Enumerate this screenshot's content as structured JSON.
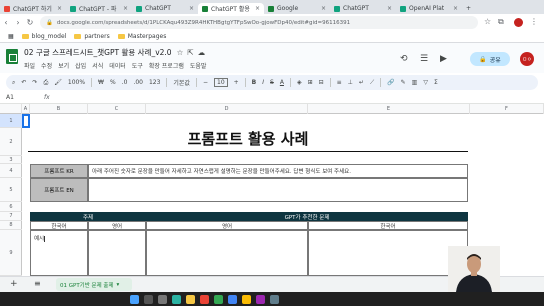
{
  "browser": {
    "tabs": [
      {
        "label": "ChatGPT 하기",
        "color": "#ea4335",
        "active": false
      },
      {
        "label": "ChatGPT - 파",
        "color": "#10a37f",
        "active": false
      },
      {
        "label": "ChatGPT",
        "color": "#10a37f",
        "active": false
      },
      {
        "label": "ChatGPT 활용",
        "color": "#188038",
        "active": true
      },
      {
        "label": "Google",
        "color": "#188038",
        "active": false
      },
      {
        "label": "ChatGPT",
        "color": "#10a37f",
        "active": false
      },
      {
        "label": "OpenAI Plat",
        "color": "#10a37f",
        "active": false
      }
    ],
    "new_tab": "+",
    "url": "docs.google.com/spreadsheets/d/1PLCKAqu493Z9R4HKTHBgtgYTFpSwOo-gjowFDp40/edit#gid=96116391",
    "bookmarks": [
      "blog_model",
      "partners",
      "Masterpages"
    ]
  },
  "sheets": {
    "doc_title": "02 구글 스프레드시트_챗GPT 활용 사례_v2.0",
    "menus": [
      "파일",
      "수정",
      "보기",
      "삽입",
      "서식",
      "데이터",
      "도구",
      "확장 프로그램",
      "도움말"
    ],
    "share_label": "공유",
    "avatar_initials": "ㅁㅇ",
    "toolbar": {
      "zoom": "100%",
      "font": "기본값",
      "font_size": "10"
    },
    "cell_ref": "A1",
    "fx": "fx",
    "columns": [
      "A",
      "B",
      "C",
      "D",
      "E",
      "F",
      "G",
      "H",
      "I"
    ],
    "rows": [
      "1",
      "2",
      "3",
      "4",
      "5",
      "6",
      "7",
      "8",
      "9",
      "10",
      "11",
      "12",
      "13"
    ]
  },
  "content": {
    "title": "프롬프트 활용 사례",
    "prompt_kr_label": "프롬프트 KR",
    "prompt_kr_value": "아래 주어진 숫자로 문장을 만들어 자세하고 자연스럽게 설명하는 문장을 만들어주세요. 답변 형식도 보여 주세요.",
    "prompt_en_label": "프롬프트 EN",
    "prompt_en_value": "",
    "input_header": "주제",
    "output_header": "GPT가 추천한 문제",
    "sub_headers": [
      "한국어",
      "영어",
      "영어",
      "한국어"
    ],
    "first_input": "예시 "
  },
  "bottom": {
    "sheet_tab": "01 GPT기반 문제 출제",
    "add": "+",
    "menu": "≡"
  }
}
